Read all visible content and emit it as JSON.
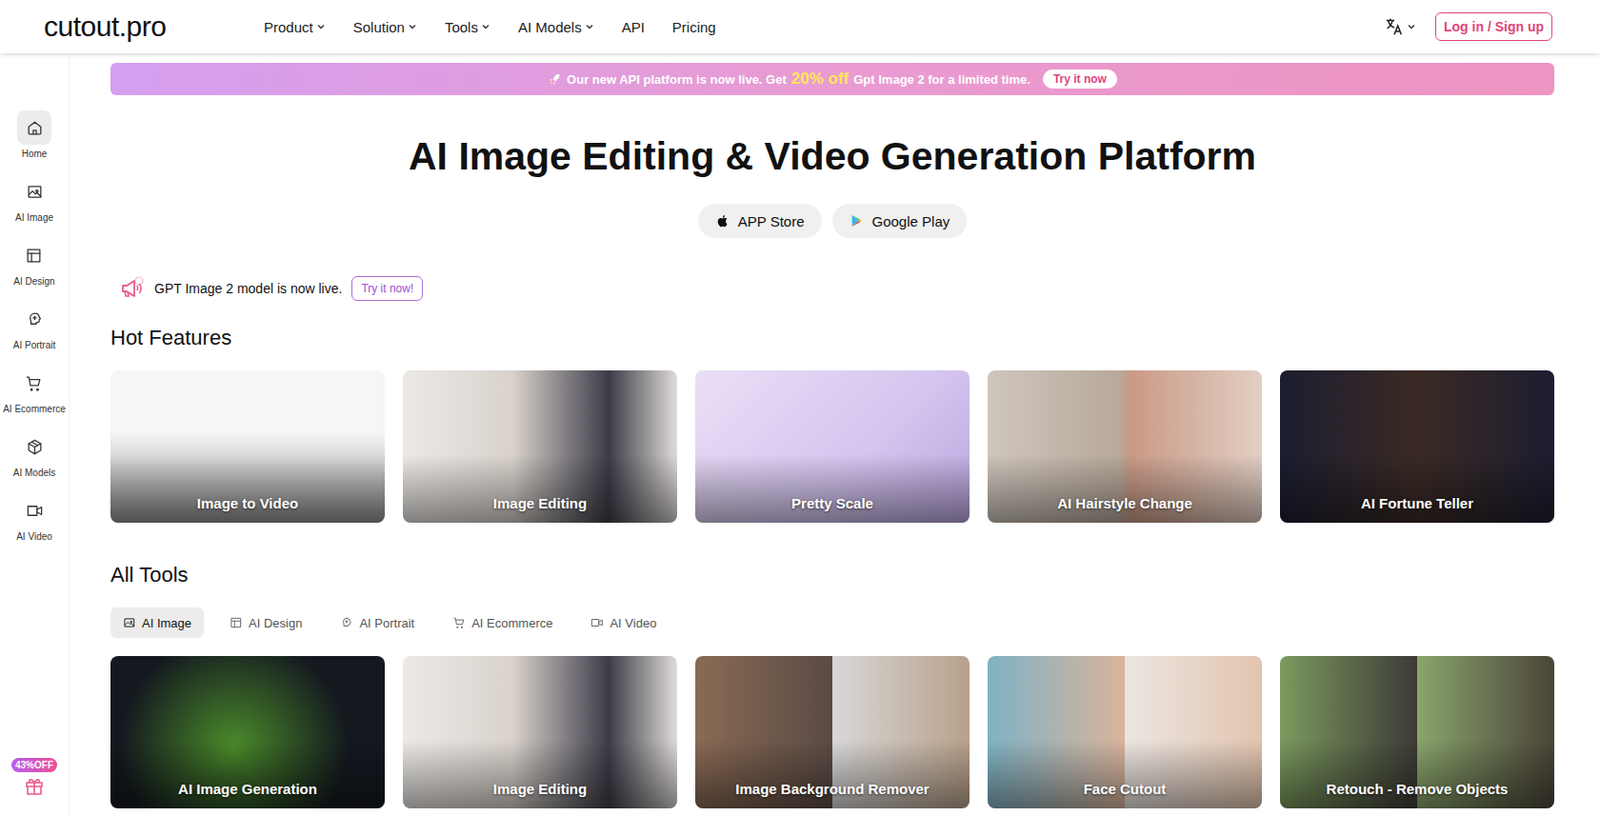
{
  "header": {
    "logo": "cutout.pro",
    "nav": [
      {
        "label": "Product",
        "dropdown": true
      },
      {
        "label": "Solution",
        "dropdown": true
      },
      {
        "label": "Tools",
        "dropdown": true
      },
      {
        "label": "AI Models",
        "dropdown": true
      },
      {
        "label": "API",
        "dropdown": false
      },
      {
        "label": "Pricing",
        "dropdown": false
      }
    ],
    "language_dropdown": true,
    "login": "Log in / Sign up"
  },
  "sidebar": {
    "items": [
      {
        "label": "Home",
        "selected": true
      },
      {
        "label": "AI Image",
        "selected": false
      },
      {
        "label": "AI Design",
        "selected": false
      },
      {
        "label": "AI Portrait",
        "selected": false
      },
      {
        "label": "AI Ecommerce",
        "selected": false
      },
      {
        "label": "AI Models",
        "selected": false
      },
      {
        "label": "AI Video",
        "selected": false
      }
    ],
    "promo": {
      "badge": "43%OFF"
    }
  },
  "banner": {
    "prefix": "Our new API platform is now live. Get",
    "highlight": "20% off",
    "suffix": "Gpt Image 2 for a limited time.",
    "button": "Try it now"
  },
  "hero": {
    "title": "AI Image Editing & Video Generation Platform",
    "stores": [
      {
        "label": "APP Store"
      },
      {
        "label": "Google Play"
      }
    ]
  },
  "notice": {
    "text": "GPT Image 2 model is now live.",
    "button": "Try it now!"
  },
  "hot_features": {
    "title": "Hot Features",
    "cards": [
      {
        "label": "Image to Video"
      },
      {
        "label": "Image Editing"
      },
      {
        "label": "Pretty Scale"
      },
      {
        "label": "AI Hairstyle Change"
      },
      {
        "label": "AI Fortune Teller"
      }
    ]
  },
  "all_tools": {
    "title": "All Tools",
    "tabs": [
      {
        "label": "AI Image",
        "selected": true
      },
      {
        "label": "AI Design",
        "selected": false
      },
      {
        "label": "AI Portrait",
        "selected": false
      },
      {
        "label": "AI Ecommerce",
        "selected": false
      },
      {
        "label": "AI Video",
        "selected": false
      }
    ],
    "cards": [
      {
        "label": "AI Image Generation"
      },
      {
        "label": "Image Editing"
      },
      {
        "label": "Image Background Remover"
      },
      {
        "label": "Face Cutout"
      },
      {
        "label": "Retouch - Remove Objects"
      }
    ]
  }
}
